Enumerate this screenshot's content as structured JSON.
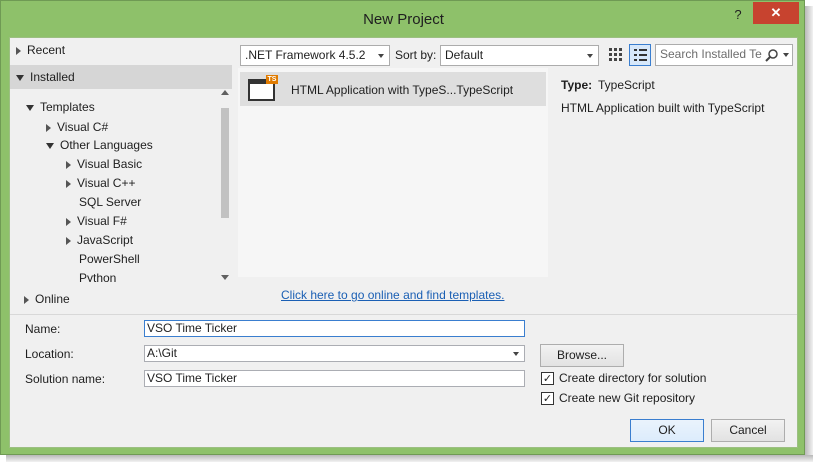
{
  "window": {
    "title": "New Project",
    "help_label": "?",
    "close_label": "✕"
  },
  "sidebar": {
    "recent_label": "Recent",
    "installed_label": "Installed",
    "templates_label": "Templates",
    "visual_csharp_label": "Visual C#",
    "other_languages_label": "Other Languages",
    "visual_basic_label": "Visual Basic",
    "visual_cpp_label": "Visual C++",
    "sql_server_label": "SQL Server",
    "visual_fsharp_label": "Visual F#",
    "javascript_label": "JavaScript",
    "powershell_label": "PowerShell",
    "python_label": "Python",
    "online_label": "Online"
  },
  "toolbar": {
    "framework_value": ".NET Framework 4.5.2",
    "sort_by_label": "Sort by:",
    "sort_value": "Default",
    "search_placeholder": "Search Installed Te"
  },
  "templates": {
    "items": [
      {
        "name": "HTML Application with TypeS...TypeScript",
        "icon_badge": "TS"
      }
    ],
    "online_link": "Click here to go online and find templates."
  },
  "details": {
    "type_label": "Type:",
    "type_value": "TypeScript",
    "description": "HTML Application built with TypeScript"
  },
  "form": {
    "name_label": "Name:",
    "name_value": "VSO Time Ticker",
    "location_label": "Location:",
    "location_value": "A:\\Git",
    "solution_name_label": "Solution name:",
    "solution_name_value": "VSO Time Ticker",
    "browse_label": "Browse...",
    "create_directory_label": "Create directory for solution",
    "create_directory_checked": "✓",
    "create_git_label": "Create new Git repository",
    "create_git_checked": "✓",
    "ok_label": "OK",
    "cancel_label": "Cancel"
  },
  "colors": {
    "frame": "#8ec16a",
    "close": "#c7432f",
    "link": "#1a5fb4",
    "selection": "#dedede"
  }
}
